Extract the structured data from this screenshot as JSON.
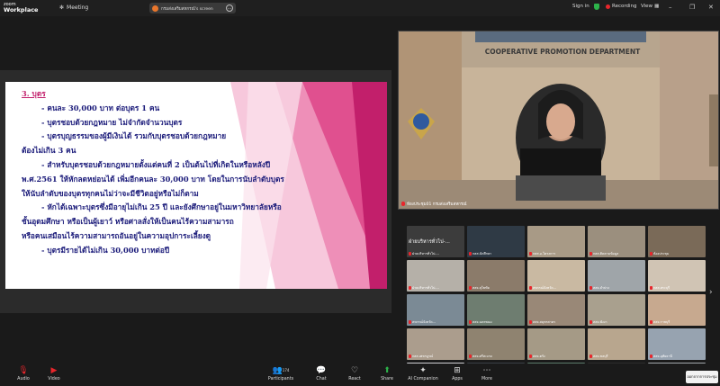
{
  "titlebar": {
    "brand_top": "zoom",
    "brand": "Workplace",
    "meeting_label": "Meeting",
    "share_label": "กรมส่งเสริมสหกรณ์'s screen",
    "signin": "Sign in",
    "recording": "Recording",
    "view": "View"
  },
  "slide": {
    "title": "3. บุตร",
    "lines": [
      "- คนละ 30,000 บาท ต่อบุตร 1 คน",
      "- บุตรชอบด้วยกฎหมาย ไม่จำกัดจำนวนบุตร",
      "- บุตรบุญธรรมของผู้มีเงินได้ รวมกับบุตรชอบด้วยกฎหมาย",
      "ต้องไม่เกิน 3 คน",
      "- สำหรับบุตรชอบด้วยกฎหมายตั้งแต่คนที่ 2 เป็นต้นไปที่เกิดในหรือหลังปี",
      "พ.ศ.2561 ให้หักลดหย่อนได้ เพิ่มอีกคนละ 30,000 บาท โดยในการนับลำดับบุตร",
      "ให้นับลำดับของบุตรทุกคนไม่ว่าจะมีชีวิตอยู่หรือไม่ก็ตาม",
      "- หักได้เฉพาะบุตรซึ่งมีอายุไม่เกิน 25 ปี และยังศึกษาอยู่ในมหาวิทยาลัยหรือ",
      "ชั้นอุดมศึกษา หรือเป็นผู้เยาว์ หรือศาลสั่งให้เป็นคนไร้ความสามารถ",
      "หรือคนเสมือนไร้ความสามารถอันอยู่ในความอุปการะเลี้ยงดู",
      "- บุตรมีรายได้ไม่เกิน 30,000 บาทต่อปี"
    ]
  },
  "speaker": {
    "sign": "COOPERATIVE PROMOTION DEPARTMENT",
    "name": "ห้องประชุม01 กรมส่งเสริมสหกรณ์"
  },
  "gallery": [
    {
      "name": "ฝ่ายบริหารทั่วไป-...",
      "big": "ฝ่ายบริหารทั่วไป-...",
      "color": "#3c3c3c"
    },
    {
      "name": "กสส.นักศึกษา",
      "color": "#2f3a45"
    },
    {
      "name": "กสส.อ.โครงการ",
      "color": "#a89a86"
    },
    {
      "name": "กสส.ติดตามข้อมูล",
      "color": "#9b8f7e"
    },
    {
      "name": "ห้องประชุม",
      "color": "#7a6a58"
    },
    {
      "name": "ฝ่ายบริหารทั่วไป-...",
      "color": "#b5b0a8"
    },
    {
      "name": "สสจ.สุโขทัย",
      "color": "#8b7b6a"
    },
    {
      "name": "สหกรณ์จังหวัด...",
      "color": "#c9b9a2"
    },
    {
      "name": "สสจ.ลำปาง",
      "color": "#9fa5a9"
    },
    {
      "name": "กสส.สระบุรี",
      "color": "#d0c4b4"
    },
    {
      "name": "สหกรณ์จังหวัด...",
      "color": "#7b8a95"
    },
    {
      "name": "สสจ.นครพนม",
      "color": "#6e7d70"
    },
    {
      "name": "สสจ.สมุทรสาคร",
      "color": "#998877"
    },
    {
      "name": "สสจ.พังงา",
      "color": "#a9a08e"
    },
    {
      "name": "สสจ.ราชบุรี",
      "color": "#c7a98f"
    },
    {
      "name": "กสส.เพชรบูรณ์",
      "color": "#ab9d8d"
    },
    {
      "name": "สสจ.ศรีสะเกษ",
      "color": "#8f8370"
    },
    {
      "name": "สสจ.ตรัง",
      "color": "#a59a86"
    },
    {
      "name": "สสจ.ชลบุรี",
      "color": "#b8a68e"
    },
    {
      "name": "สสจ.อุทัยธานี",
      "color": "#97a3b0"
    },
    {
      "name": "สสจ.กาญจนบุรี",
      "color": "#cfcfd4"
    },
    {
      "name": "สสจ.บุรีรัมย์",
      "color": "#3a3f46"
    },
    {
      "name": "กสส.สตูล",
      "color": "#5b7a6a"
    },
    {
      "name": "สสจ.ลพบุรี",
      "color": "#2c2c2c"
    },
    {
      "name": "สสจ.สงขลา",
      "color": "#a3a8ad"
    }
  ],
  "toolbar": {
    "audio": "Audio",
    "video": "Video",
    "participants": "Participants",
    "participants_count": "174",
    "chat": "Chat",
    "react": "React",
    "share": "Share",
    "ai": "AI Companion",
    "apps": "Apps",
    "more": "More",
    "leave": "ออกจากการประชุม"
  }
}
